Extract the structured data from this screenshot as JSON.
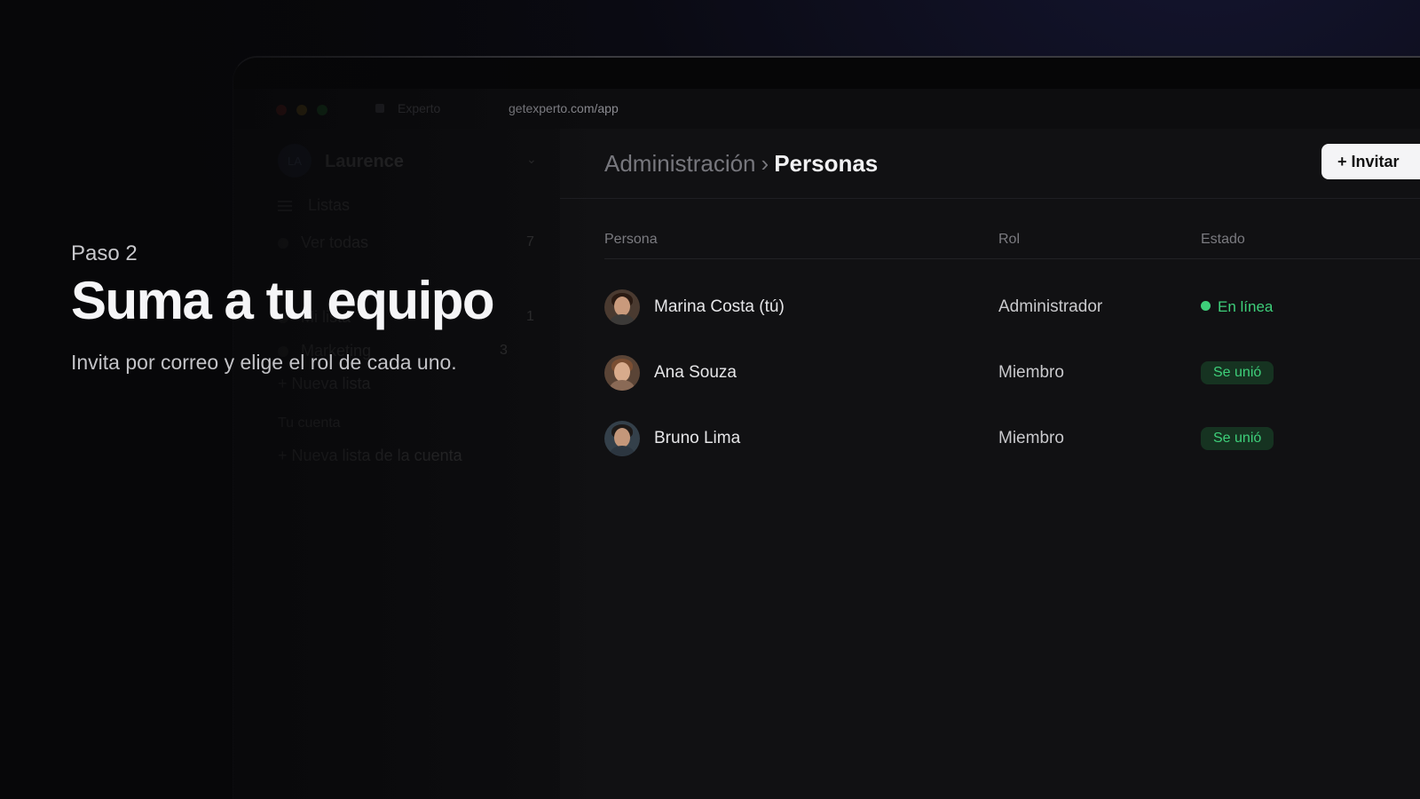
{
  "browser": {
    "tab_title": "Experto",
    "url": "getexperto.com/app"
  },
  "sidebar": {
    "avatar_initials": "LA",
    "user_name": "Laurence",
    "items": [
      {
        "label": "Listas"
      },
      {
        "label": "Ver todas",
        "count": "7"
      },
      {
        "label": "Mi lista",
        "count": "1"
      },
      {
        "label": "Marketing",
        "count": "3"
      },
      {
        "label": "+ Nueva lista"
      },
      {
        "label": "Tu cuenta"
      },
      {
        "label": "+ Nueva lista de la cuenta"
      }
    ]
  },
  "header": {
    "breadcrumb_parent": "Administración",
    "breadcrumb_separator": "›",
    "breadcrumb_current": "Personas",
    "invite_button": "+ Invitar"
  },
  "table": {
    "columns": [
      "Persona",
      "Rol",
      "Estado"
    ],
    "rows": [
      {
        "name": "Marina Costa (tú)",
        "role": "Administrador",
        "status": "En línea",
        "status_type": "online"
      },
      {
        "name": "Ana Souza",
        "role": "Miembro",
        "status": "Se unió",
        "status_type": "badge"
      },
      {
        "name": "Bruno Lima",
        "role": "Miembro",
        "status": "Se unió",
        "status_type": "badge"
      }
    ]
  },
  "overlay": {
    "step": "Paso 2",
    "headline": "Suma a tu equipo",
    "subline": "Invita por correo y elige el rol de cada uno."
  },
  "colors": {
    "accent_green": "#3ecf7a",
    "badge_bg": "#163321",
    "background": "#07070a"
  }
}
